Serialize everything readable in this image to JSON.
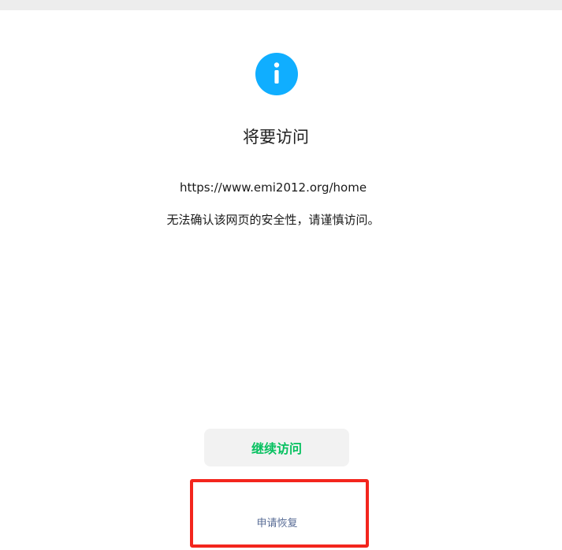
{
  "dialog": {
    "title": "将要访问",
    "url": "https://www.emi2012.org/home",
    "warning": "无法确认该网页的安全性，请谨慎访问。",
    "icon": "info-icon"
  },
  "actions": {
    "continue_label": "继续访问",
    "appeal_label": "申请恢复"
  },
  "colors": {
    "accent_icon": "#10aeff",
    "continue_text": "#07c160",
    "link_text": "#576b95",
    "highlight_border": "#f3251d"
  }
}
